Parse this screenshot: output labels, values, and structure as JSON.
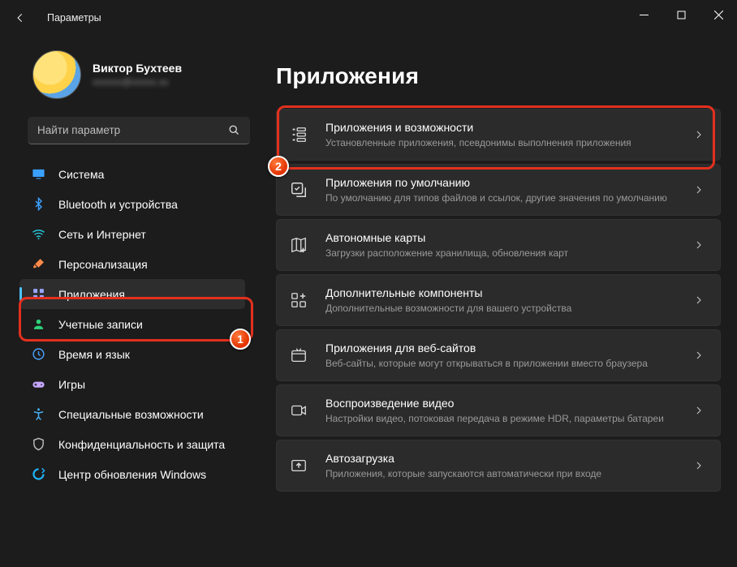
{
  "window": {
    "title": "Параметры"
  },
  "profile": {
    "name": "Виктор Бухтеев",
    "email": "xxxxxx@xxxxx.xx"
  },
  "search": {
    "placeholder": "Найти параметр"
  },
  "page": {
    "title": "Приложения"
  },
  "nav": [
    {
      "label": "Система",
      "icon": "system-icon",
      "color": "#3aa0ff"
    },
    {
      "label": "Bluetooth и устройства",
      "icon": "bluetooth-icon",
      "color": "#3aa0ff"
    },
    {
      "label": "Сеть и Интернет",
      "icon": "wifi-icon",
      "color": "#26c6da"
    },
    {
      "label": "Персонализация",
      "icon": "paintbrush-icon",
      "color": "#ff8a4a"
    },
    {
      "label": "Приложения",
      "icon": "apps-icon",
      "color": "#9aa6ff",
      "selected": true
    },
    {
      "label": "Учетные записи",
      "icon": "account-icon",
      "color": "#2fd27a"
    },
    {
      "label": "Время и язык",
      "icon": "time-language-icon",
      "color": "#4aa3ff"
    },
    {
      "label": "Игры",
      "icon": "gaming-icon",
      "color": "#c6a7ff"
    },
    {
      "label": "Специальные возможности",
      "icon": "accessibility-icon",
      "color": "#4ab6ff"
    },
    {
      "label": "Конфиденциальность и защита",
      "icon": "privacy-icon",
      "color": "#bdbdbd"
    },
    {
      "label": "Центр обновления Windows",
      "icon": "windows-update-icon",
      "color": "#1fb6ff"
    }
  ],
  "cards": [
    {
      "title": "Приложения и возможности",
      "desc": "Установленные приложения, псевдонимы выполнения приложения",
      "icon": "apps-features-icon",
      "highlight": true
    },
    {
      "title": "Приложения по умолчанию",
      "desc": "По умолчанию для типов файлов и ссылок, другие значения по умолчанию",
      "icon": "default-apps-icon"
    },
    {
      "title": "Автономные карты",
      "desc": "Загрузки расположение хранилища, обновления карт",
      "icon": "maps-icon"
    },
    {
      "title": "Дополнительные компоненты",
      "desc": "Дополнительные возможности для вашего устройства",
      "icon": "optional-features-icon"
    },
    {
      "title": "Приложения для веб-сайтов",
      "desc": "Веб-сайты, которые могут открываться в приложении вместо браузера",
      "icon": "websites-icon"
    },
    {
      "title": "Воспроизведение видео",
      "desc": "Настройки видео, потоковая передача в режиме HDR, параметры батареи",
      "icon": "video-icon"
    },
    {
      "title": "Автозагрузка",
      "desc": "Приложения, которые запускаются автоматически при входе",
      "icon": "startup-icon"
    }
  ],
  "annotations": {
    "badge1": "1",
    "badge2": "2"
  }
}
